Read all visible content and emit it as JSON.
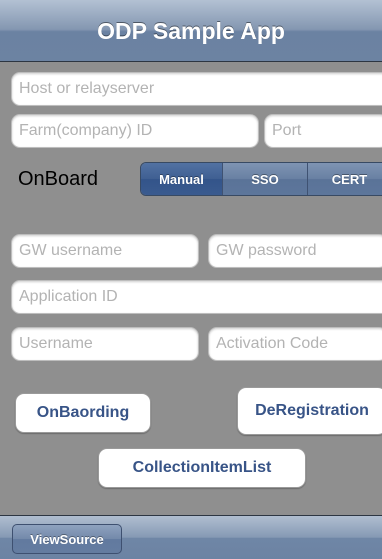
{
  "navbar": {
    "title": "ODP Sample App"
  },
  "fields": {
    "host": {
      "placeholder": "Host or relayserver",
      "value": ""
    },
    "farm": {
      "placeholder": "Farm(company) ID",
      "value": ""
    },
    "port": {
      "placeholder": "Port",
      "value": ""
    },
    "gw_username": {
      "placeholder": "GW username",
      "value": ""
    },
    "gw_password": {
      "placeholder": "GW password",
      "value": ""
    },
    "application_id": {
      "placeholder": "Application ID",
      "value": ""
    },
    "username": {
      "placeholder": "Username",
      "value": ""
    },
    "activation_code": {
      "placeholder": "Activation Code",
      "value": ""
    }
  },
  "onboard": {
    "label": "OnBoard",
    "segments": [
      "Manual",
      "SSO",
      "CERT"
    ],
    "selected": "Manual"
  },
  "buttons": {
    "onboarding": "OnBaording",
    "deregistration": "DeRegistration",
    "collection_item_list": "CollectionItemList"
  },
  "toolbar": {
    "view_source": "ViewSource"
  }
}
